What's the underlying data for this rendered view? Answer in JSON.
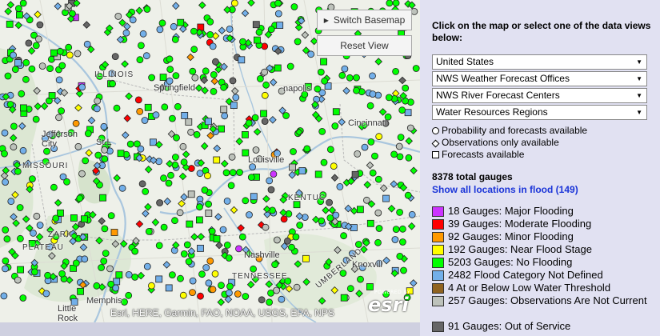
{
  "map": {
    "buttons": {
      "switch_basemap": "Switch Basemap",
      "reset_view": "Reset View"
    },
    "attribution": "Esri, HERE, Garmin, FAO, NOAA, USGS, EPA, NPS",
    "logo": {
      "powered_by": "POWERED BY",
      "name": "esri"
    },
    "labels": {
      "illinois": "ILLINOIS",
      "springfield": "Springfield",
      "indianapolis": "napolis",
      "cincinnati": "Cincinnati",
      "jefferson_city": "Jefferson City",
      "st_louis": "St L",
      "missouri": "MISSOURI",
      "louisville": "Louisville",
      "kentucky": "KENTUC",
      "ozark": "ZARK",
      "plateau": "PLATEAU",
      "nashville": "Nashville",
      "tennessee": "TENNESSEE",
      "knoxville": "Knoxvill",
      "memphis": "Memphis",
      "little_rock": "Little Rock",
      "cumberland": "UMBERLAND"
    },
    "colors": {
      "major": "#cc33ff",
      "moderate": "#ff0000",
      "minor": "#ff9900",
      "near": "#ffff00",
      "none": "#00ff00",
      "undefined": "#72afe9",
      "low": "#906320",
      "obs": "#bdc2bb",
      "oos": "#666666"
    }
  },
  "panel": {
    "intro": "Click on the map or select one of the data views below:",
    "selects": [
      "United States",
      "NWS Weather Forecast Offices",
      "NWS River Forecast Centers",
      "Water Resources Regions"
    ],
    "shapes": {
      "circle": "Probability and forecasts available",
      "diamond": "Observations only available",
      "square": "Forecasts available"
    },
    "total": "8378 total gauges",
    "flood_link": "Show all locations in flood (149)",
    "categories": [
      {
        "label": "18 Gauges: Major Flooding",
        "color": "#cc33ff"
      },
      {
        "label": "39 Gauges: Moderate Flooding",
        "color": "#ff0000"
      },
      {
        "label": "92 Gauges: Minor Flooding",
        "color": "#ff9900"
      },
      {
        "label": "192 Gauges: Near Flood Stage",
        "color": "#ffff00"
      },
      {
        "label": "5203 Gauges: No Flooding",
        "color": "#00ff00"
      },
      {
        "label": "2482 Flood Category Not Defined",
        "color": "#72afe9"
      },
      {
        "label": "4 At or Below Low Water Threshold",
        "color": "#906320"
      },
      {
        "label": "257 Gauges: Observations Are Not Current",
        "color": "#bdc2bb"
      },
      {
        "label": "91 Gauges: Out of Service",
        "color": "#666666"
      }
    ]
  }
}
